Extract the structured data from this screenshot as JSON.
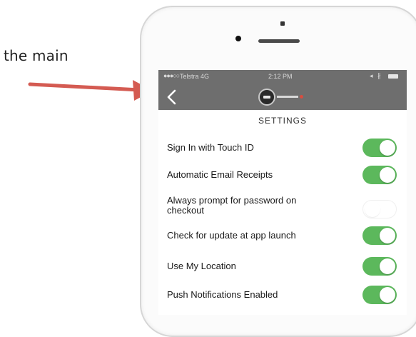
{
  "caption": "o the main",
  "status_bar": {
    "signal": "●●●○○",
    "carrier": "Telstra  4G",
    "time": "2:12 PM",
    "right_icons": "◂ ∦"
  },
  "nav": {
    "back_label": "<"
  },
  "settings": {
    "title": "SETTINGS",
    "rows": [
      {
        "label": "Sign In with Touch ID",
        "enabled": true
      },
      {
        "label": "Automatic Email Receipts",
        "enabled": true
      },
      {
        "label": "Always prompt for password on checkout",
        "enabled": false
      },
      {
        "label": "Check for update at app launch",
        "enabled": true
      },
      {
        "label": "Use My Location",
        "enabled": true
      },
      {
        "label": "Push Notifications Enabled",
        "enabled": true
      }
    ]
  },
  "colors": {
    "toggle_on": "#5cb85c",
    "navbar": "#6e6e6e",
    "arrow": "#d45b52"
  },
  "icons": {
    "arrow": "pointing-arrow-icon",
    "back": "chevron-left-icon",
    "logo": "app-logo-icon"
  }
}
